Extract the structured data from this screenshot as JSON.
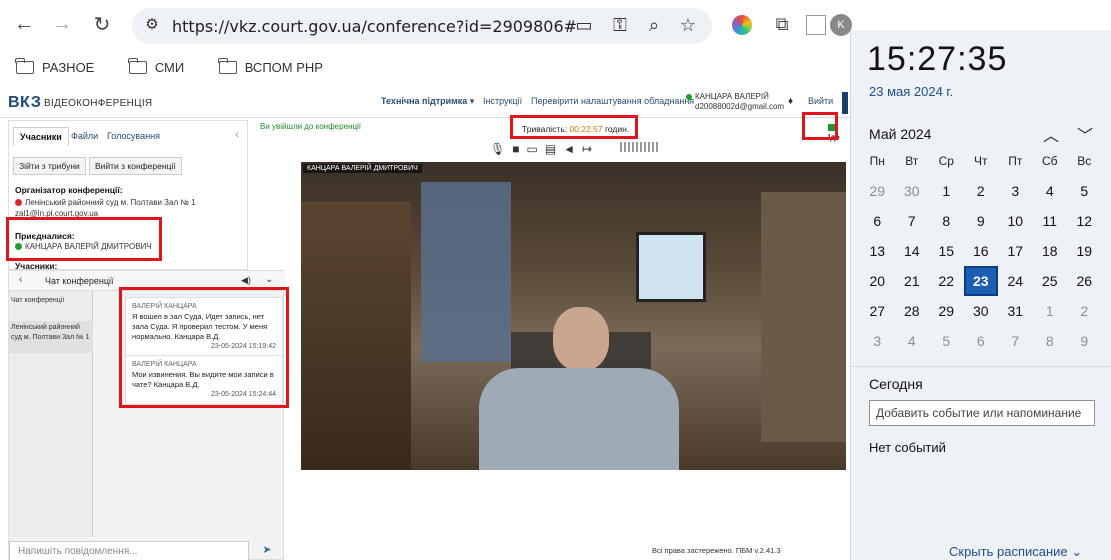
{
  "browser": {
    "url": "https://vkz.court.gov.ua/conference?id=2909806#",
    "profile_initial": "K",
    "bookmarks": [
      "РАЗНОЕ",
      "СМИ",
      "ВСПОМ РНР"
    ]
  },
  "app": {
    "logo": "ВКЗ",
    "logo_sub": "ВІДЕОКОНФЕРЕНЦІЯ",
    "header_links": [
      "Технічна підтримка ▾",
      "Інструкції",
      "Перевірити налаштування обладнання"
    ],
    "user_name": "КАНЦАРА ВАЛЕРІЙ",
    "user_email": "d20088002d@gmail.com",
    "exit_label": "Вийти"
  },
  "left": {
    "tabs": [
      "Учасники",
      "Файли",
      "Голосування"
    ],
    "buttons": [
      "Зійти з трибуни",
      "Вийти з конференції"
    ],
    "organizer_label": "Організатор конференції:",
    "organizer_name": "Ленінський районний суд м. Полтави Зал № 1",
    "organizer_email": "zal1@ln.pl.court.gov.ua",
    "joined_label": "Приєдналися:",
    "joined_name": "КАНЦАРА ВАЛЕРІЙ ДМИТРОВИЧ",
    "participants_label": "Учасники:"
  },
  "chat": {
    "title": "Чат конференції",
    "list_header": "Чат конференції",
    "list_item": "Ленінський районний суд м. Полтави Зал № 1",
    "messages": [
      {
        "author": "ВАЛЕРІЙ КАНЦАРА",
        "text": "Я вошел в зал Суда, Идет запись, нет зала Суда. Я проверил тестом. У меня нормально. Канцара В.Д.",
        "time": "23-05-2024 15:19:42"
      },
      {
        "author": "ВАЛЕРІЙ КАНЦАРА",
        "text": "Мои извинения. Вы видите мои записи в чате? Канцара В.Д.",
        "time": "23-05-2024 15:24:44"
      }
    ],
    "input_placeholder": "Напишіть повідомлення..."
  },
  "conference": {
    "entered_text": "Ви увійшли до конференції",
    "duration_label": "Тривалість:",
    "duration_value": "00:22:57",
    "duration_unit": "годин.",
    "live_label": "Іде",
    "video_label": "КАНЦАРА ВАЛЕРІЙ ДМИТРОВИЧ",
    "footer": "Всі права застережено. ПБМ v.2.41.3"
  },
  "flyout": {
    "time": "15:27:35",
    "date": "23 мая 2024 г.",
    "month": "Май 2024",
    "weekdays": [
      "Пн",
      "Вт",
      "Ср",
      "Чт",
      "Пт",
      "Сб",
      "Вс"
    ],
    "days": [
      [
        "29",
        "30",
        "1",
        "2",
        "3",
        "4",
        "5"
      ],
      [
        "6",
        "7",
        "8",
        "9",
        "10",
        "11",
        "12"
      ],
      [
        "13",
        "14",
        "15",
        "16",
        "17",
        "18",
        "19"
      ],
      [
        "20",
        "21",
        "22",
        "23",
        "24",
        "25",
        "26"
      ],
      [
        "27",
        "28",
        "29",
        "30",
        "31",
        "1",
        "2"
      ],
      [
        "3",
        "4",
        "5",
        "6",
        "7",
        "8",
        "9"
      ]
    ],
    "today_label": "Сегодня",
    "event_placeholder": "Добавить событие или напоминание",
    "no_events": "Нет событий",
    "hide_schedule": "Скрыть расписание"
  }
}
